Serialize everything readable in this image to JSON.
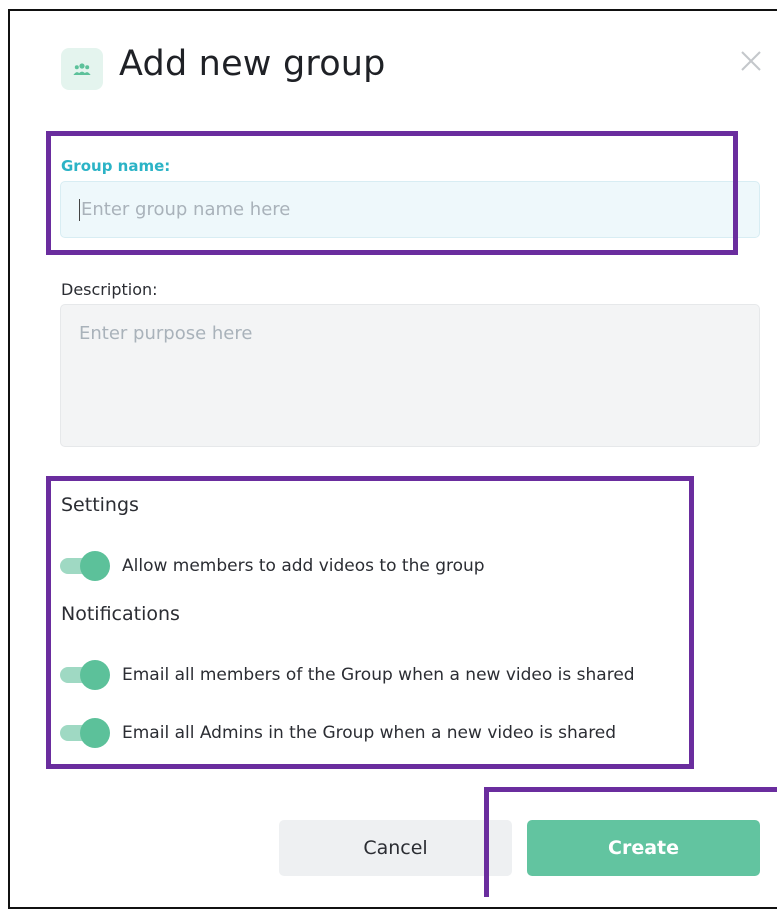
{
  "dialog": {
    "title": "Add new group",
    "header_icon": "group-icon",
    "close_icon": "close-icon"
  },
  "form": {
    "group_name": {
      "label": "Group name:",
      "value": "",
      "placeholder": "Enter group name here"
    },
    "description": {
      "label": "Description:",
      "value": "",
      "placeholder": "Enter purpose here"
    }
  },
  "settings": {
    "title": "Settings",
    "toggles": [
      {
        "label": "Allow members to add videos to the group",
        "on": true
      }
    ]
  },
  "notifications": {
    "title": "Notifications",
    "toggles": [
      {
        "label": "Email all members of the Group when a new video is shared",
        "on": true
      },
      {
        "label": "Email all Admins in the Group when a new video is shared",
        "on": true
      }
    ]
  },
  "actions": {
    "cancel_label": "Cancel",
    "create_label": "Create"
  },
  "colors": {
    "accent_teal": "#2bb3c6",
    "toggle_on": "#5cc19a",
    "create_button": "#62c4a0",
    "highlight_box": "#6a2d9e"
  }
}
